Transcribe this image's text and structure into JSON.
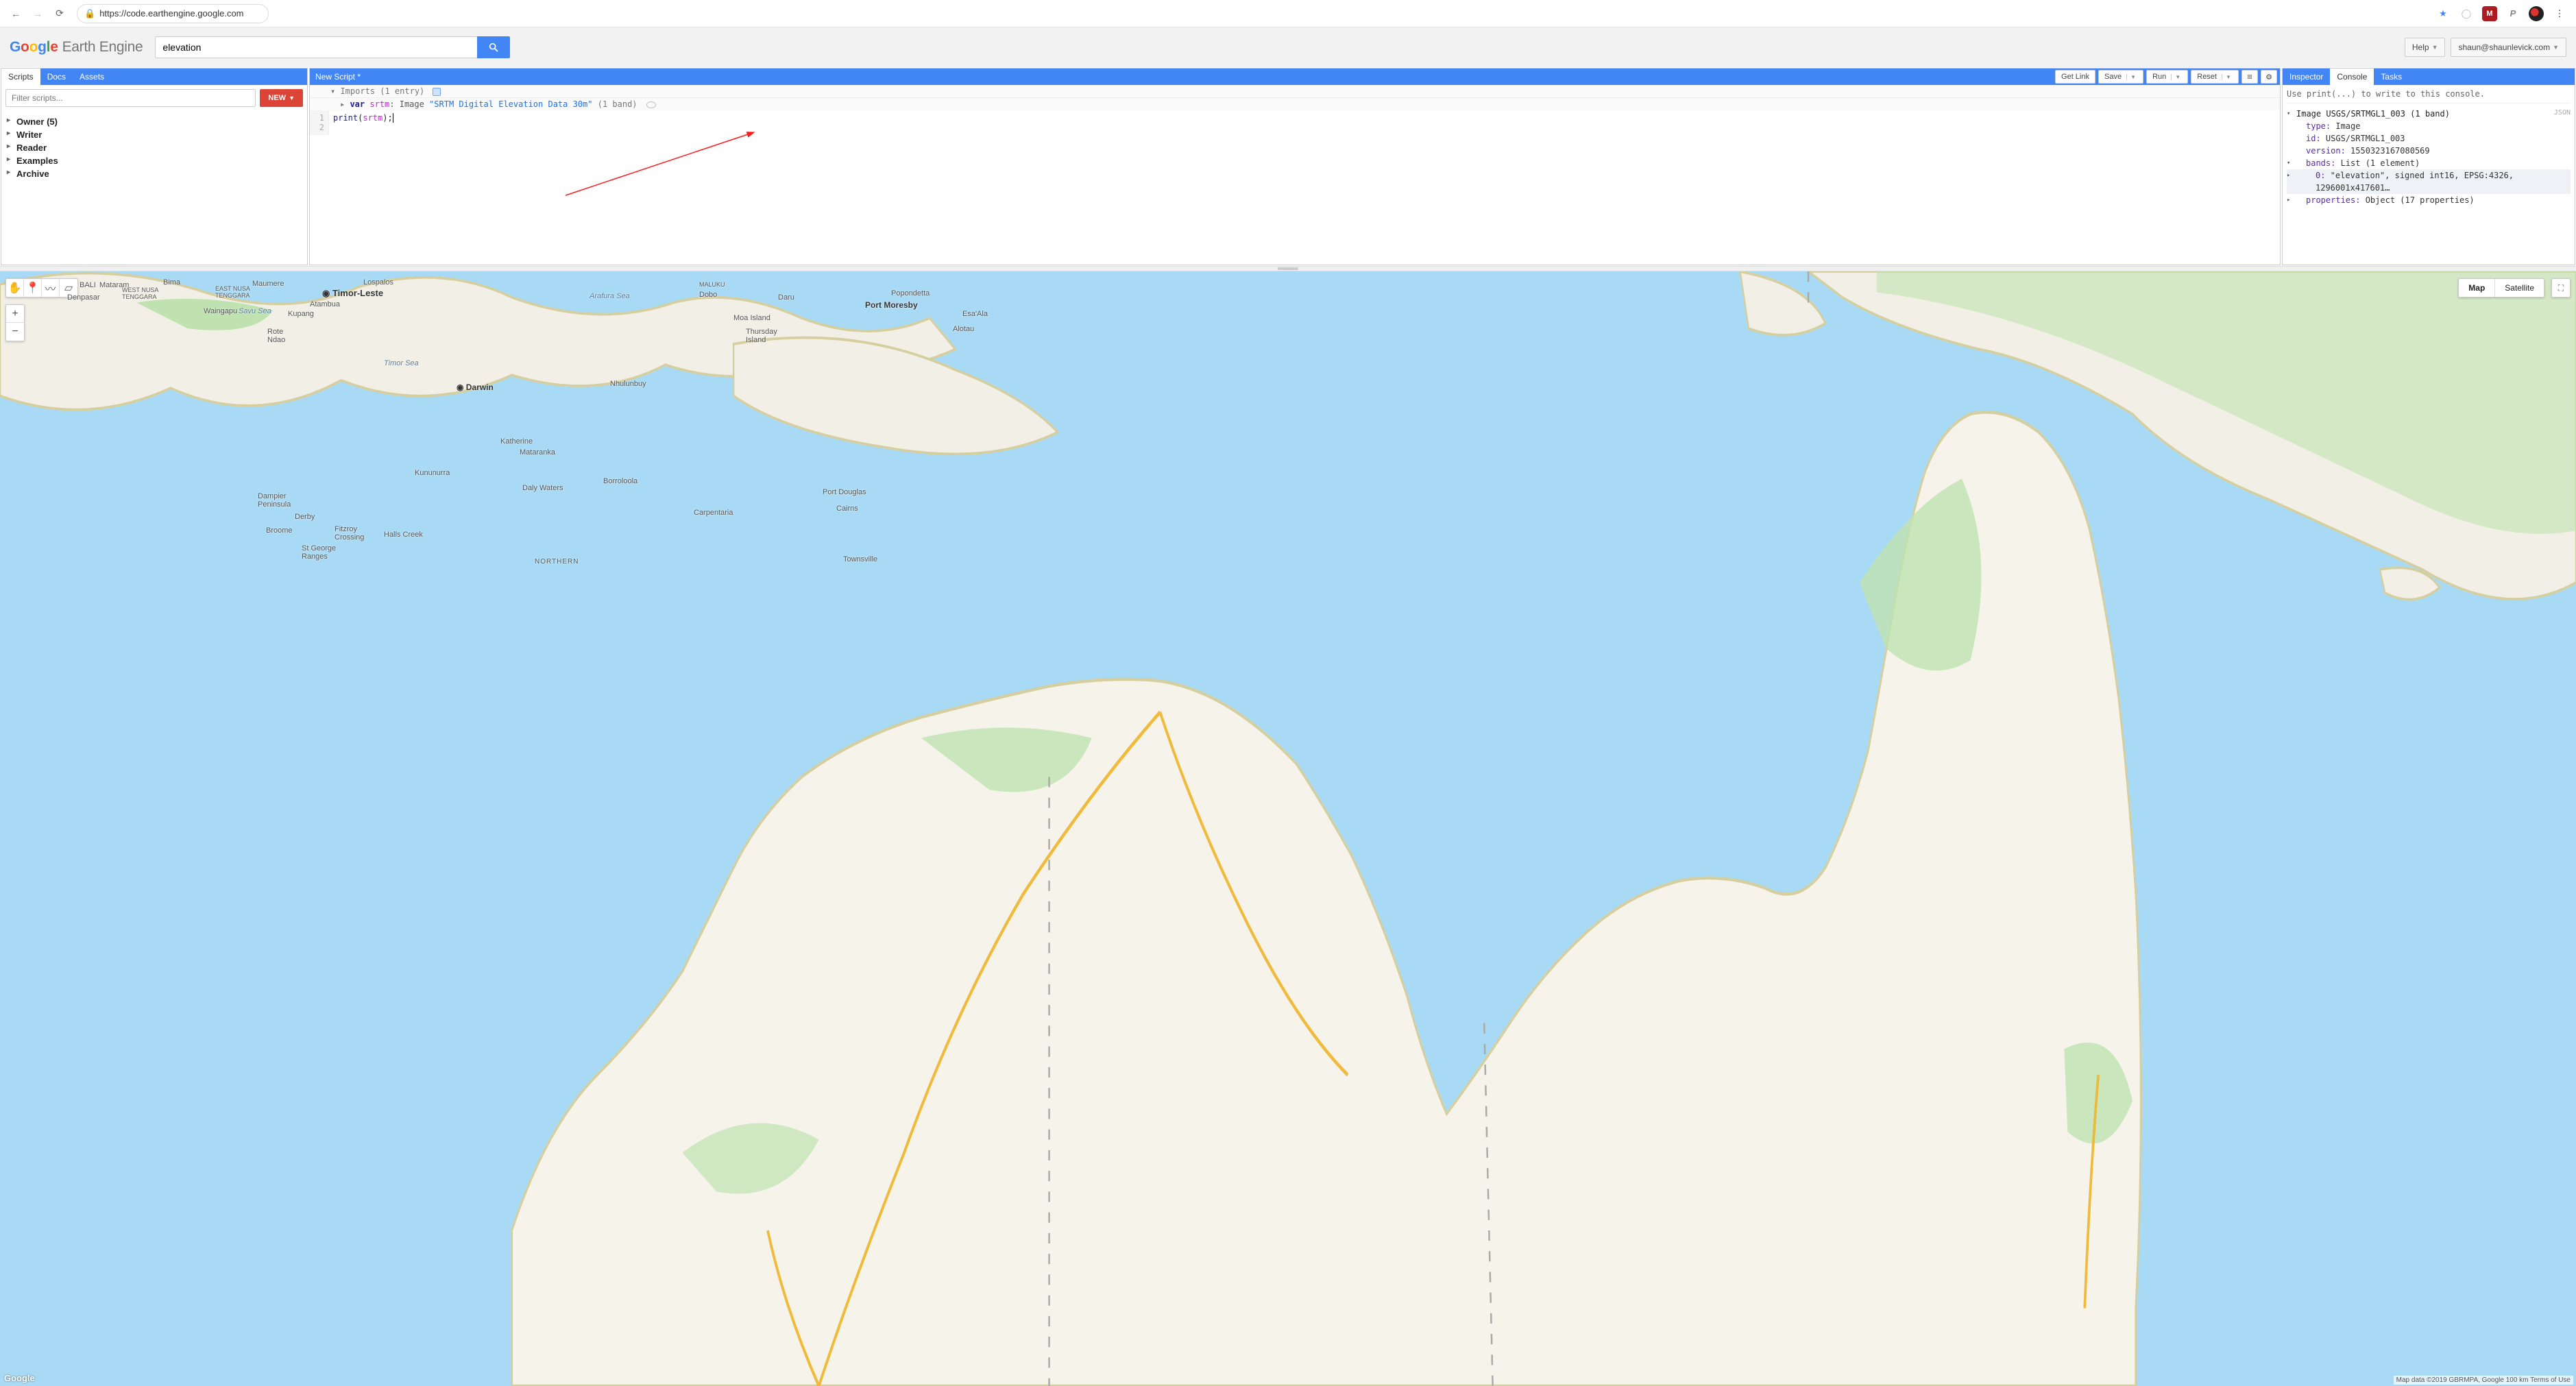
{
  "browser": {
    "url_display": "https://code.earthengine.google.com"
  },
  "logo": {
    "g1": "G",
    "g2": "o",
    "g3": "o",
    "g4": "g",
    "g5": "l",
    "g6": "e",
    "product": "Earth Engine"
  },
  "search": {
    "value": "elevation"
  },
  "top_buttons": {
    "help": "Help",
    "account": "shaun@shaunlevick.com"
  },
  "left": {
    "tabs": {
      "scripts": "Scripts",
      "docs": "Docs",
      "assets": "Assets"
    },
    "filter_placeholder": "Filter scripts...",
    "new_button": "NEW",
    "tree": [
      "Owner  (5)",
      "Writer",
      "Reader",
      "Examples",
      "Archive"
    ]
  },
  "center": {
    "title": "New Script *",
    "buttons": {
      "get_link": "Get Link",
      "save": "Save",
      "run": "Run",
      "reset": "Reset"
    },
    "imports_label": "Imports (1 entry)",
    "import_var": "var",
    "import_name": "srtm",
    "import_type": ": Image ",
    "import_dataset": "\"SRTM Digital Elevation Data 30m\"",
    "import_bands": " (1 band) ",
    "code_line1": "print(srtm);"
  },
  "right": {
    "tabs": {
      "inspector": "Inspector",
      "console": "Console",
      "tasks": "Tasks"
    },
    "hint": "Use print(...) to write to this console.",
    "json_badge": "JSON",
    "obj_header": "Image USGS/SRTMGL1_003 (1 band)",
    "type_k": "type:",
    "type_v": " Image",
    "id_k": "id:",
    "id_v": " USGS/SRTMGL1_003",
    "version_k": "version:",
    "version_v": " 1550323167080569",
    "bands_k": "bands:",
    "bands_v": " List (1 element)",
    "band0_k": "0:",
    "band0_v": " \"elevation\", signed int16, EPSG:4326, 1296001x417601…",
    "props_k": "properties:",
    "props_v": " Object (17 properties)"
  },
  "map": {
    "type_map": "Map",
    "type_sat": "Satellite",
    "google": "Google",
    "attrib": "Map data ©2019 GBRMPA, Google     100 km     Terms of Use",
    "labels": {
      "bali": "BALI",
      "mataram": "Mataram",
      "westnusa": "WEST NUSA\nTENGGARA",
      "denpasar": "Denpasar",
      "bima": "Bima",
      "eastnusa": "EAST NUSA\nTENGGARA",
      "waingapu": "Waingapu",
      "savu": "Savu Sea",
      "maumere": "Maumere",
      "lospalos": "Lospalos",
      "timorleste": "◉ Timor-Leste",
      "kupang": "Kupang",
      "atambua": "Atambua",
      "rote": "Rote\nNdao",
      "timorsea": "Timor Sea",
      "arafura": "Arafura Sea",
      "maluku": "MALUKU",
      "dobo": "Dobo",
      "moaisland": "Moa Island",
      "thursday": "Thursday\nIsland",
      "popondetta": "Popondetta",
      "portmoresby": "Port Moresby",
      "esaala": "Esa'Ala",
      "alotau": "Alotau",
      "daru": "Daru",
      "nhulunbuy": "Nhulunbuy",
      "darwin": "◉ Darwin",
      "katherine": "Katherine",
      "mataranka": "Mataranka",
      "kununurra": "Kununurra",
      "borroloola": "Borroloola",
      "dalywaters": "Daly Waters",
      "dampier": "Dampier\nPeninsula",
      "broome": "Broome",
      "derby": "Derby",
      "fitzroy": "Fitzroy\nCrossing",
      "hallscreek": "Halls Creek",
      "stgeorge": "St George\nRanges",
      "carpentaria": "Carpentaria",
      "portdouglas": "Port Douglas",
      "cairns": "Cairns",
      "townsville": "Townsville",
      "northern": "NORTHERN"
    }
  }
}
